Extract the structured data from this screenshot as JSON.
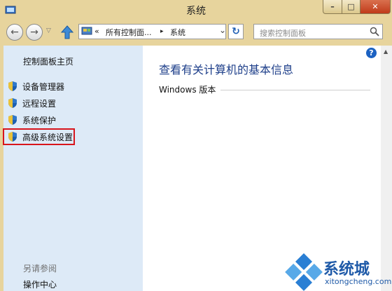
{
  "window": {
    "title": "系统"
  },
  "titlebar": {
    "min": "–",
    "max": "□",
    "close": "✕"
  },
  "navbar": {
    "back": "←",
    "forward": "→",
    "recent": "▽",
    "address": [
      "«",
      "所有控制面...",
      "▸",
      "系统"
    ],
    "address_dropdown": "⌄",
    "refresh": "↻",
    "search_placeholder": "搜索控制面板"
  },
  "left_pane": {
    "home_link": "控制面板主页",
    "tasks": [
      {
        "label": "设备管理器",
        "icon": "uac-shield-icon"
      },
      {
        "label": "远程设置",
        "icon": "uac-shield-icon"
      },
      {
        "label": "系统保护",
        "icon": "uac-shield-icon"
      },
      {
        "label": "高级系统设置",
        "icon": "uac-shield-icon",
        "highlighted": true
      }
    ],
    "see_also": "另请参阅",
    "action_center": "操作中心"
  },
  "main": {
    "help": "?",
    "heading": "查看有关计算机的基本信息",
    "section": "Windows 版本"
  },
  "watermark": {
    "text": "系统城",
    "url": "xitongcheng.com"
  },
  "colors": {
    "highlight": "#d8151c",
    "heading": "#1e3f8a",
    "left_pane": "#ddeaf7",
    "frame": "#e7d49d"
  }
}
